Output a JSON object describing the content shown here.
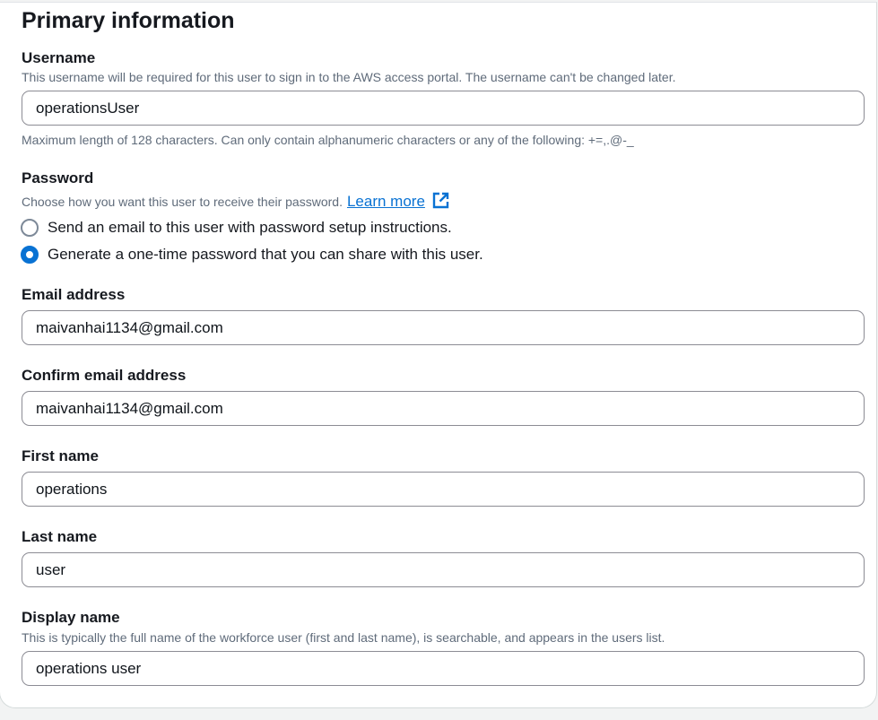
{
  "section": {
    "title": "Primary information"
  },
  "username": {
    "label": "Username",
    "description": "This username will be required for this user to sign in to the AWS access portal. The username can't be changed later.",
    "value": "operationsUser",
    "constraint": "Maximum length of 128 characters. Can only contain alphanumeric characters or any of the following: +=,.@-_"
  },
  "password": {
    "label": "Password",
    "description": "Choose how you want this user to receive their password.",
    "learn_more": "Learn more",
    "options": [
      {
        "label": "Send an email to this user with password setup instructions.",
        "selected": false
      },
      {
        "label": "Generate a one-time password that you can share with this user.",
        "selected": true
      }
    ]
  },
  "email": {
    "label": "Email address",
    "value": "maivanhai1134@gmail.com"
  },
  "confirm_email": {
    "label": "Confirm email address",
    "value": "maivanhai1134@gmail.com"
  },
  "first_name": {
    "label": "First name",
    "value": "operations"
  },
  "last_name": {
    "label": "Last name",
    "value": "user"
  },
  "display_name": {
    "label": "Display name",
    "description": "This is typically the full name of the workforce user (first and last name), is searchable, and appears in the users list.",
    "value": "operations user"
  },
  "colors": {
    "link": "#0972d3",
    "radio_selected": "#0972d3",
    "text": "#16191f",
    "muted": "#5f6b7a",
    "border": "#8c8c94"
  },
  "icons": {
    "external_link": "external-link-icon"
  }
}
